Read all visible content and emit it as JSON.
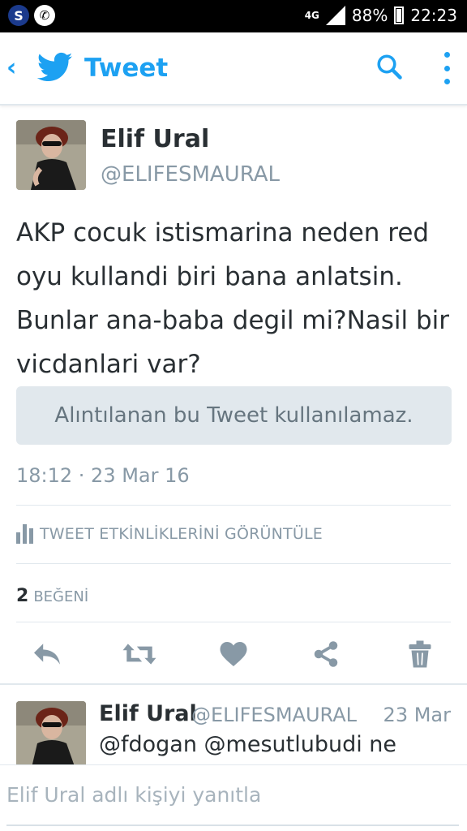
{
  "status_bar": {
    "network": "4G",
    "battery": "88%",
    "time": "22:23"
  },
  "header": {
    "title": "Tweet",
    "back_icon": "chevron-left-icon",
    "logo_icon": "twitter-bird-icon",
    "search_icon": "search-icon",
    "more_icon": "more-vertical-icon",
    "accent_color": "#1da1f2"
  },
  "tweet": {
    "author_name": "Elif Ural",
    "author_handle": "@ELIFESMAURAL",
    "text": "AKP cocuk istismarina neden red oyu kullandi biri bana anlatsin. Bunlar ana-baba degil mi?Nasil bir vicdanlari var?",
    "quote_unavailable": "Alıntılanan bu Tweet kullanılamaz.",
    "timestamp": "18:12 · 23 Mar 16",
    "activity_label": "TWEET ETKİNLİKLERİNİ GÖRÜNTÜLE",
    "likes_count": "2",
    "likes_label": "BEĞENİ",
    "actions": [
      "reply-icon",
      "retweet-icon",
      "heart-icon",
      "share-icon",
      "trash-icon"
    ]
  },
  "reply": {
    "author_name": "Elif Ural",
    "author_handle": "@ELIFESMAURAL",
    "time": "23 Mar",
    "text": "@fdogan @mesutlubudi ne"
  },
  "compose": {
    "placeholder": "Elif Ural adlı kişiyi yanıtla"
  }
}
